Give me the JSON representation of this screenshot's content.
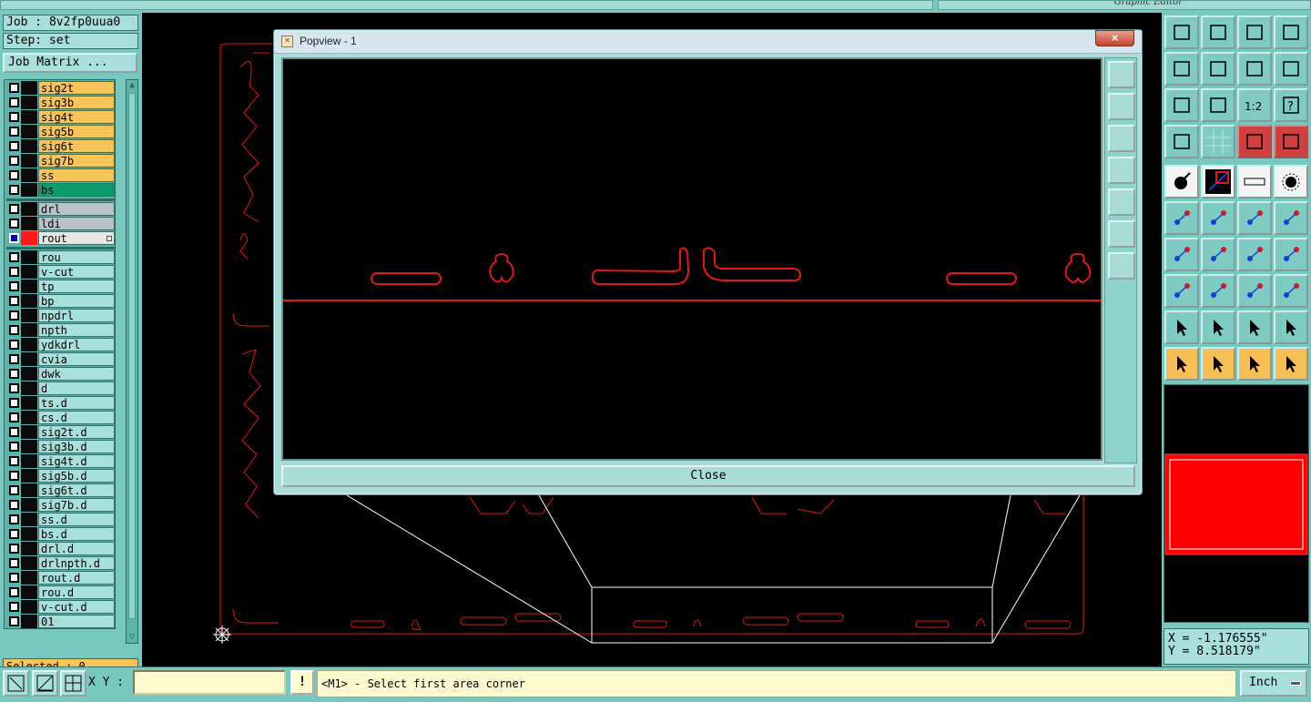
{
  "app": {
    "title": "Graphic Editor"
  },
  "left_panel": {
    "job_label": "Job : 8v2fp0uua0",
    "step_label": "Step: set",
    "job_matrix_button": "Job Matrix ...",
    "layers_group1": [
      {
        "name": "sig2t",
        "color": "#f7c45a"
      },
      {
        "name": "sig3b",
        "color": "#f7c45a"
      },
      {
        "name": "sig4t",
        "color": "#f7c45a"
      },
      {
        "name": "sig5b",
        "color": "#f7c45a"
      },
      {
        "name": "sig6t",
        "color": "#f7c45a"
      },
      {
        "name": "sig7b",
        "color": "#f7c45a"
      },
      {
        "name": "ss",
        "color": "#f7c45a"
      },
      {
        "name": "bs",
        "color": "#0e9a6c"
      }
    ],
    "layers_group2": [
      {
        "name": "drl",
        "color": "#b7c3c6"
      },
      {
        "name": "ldi",
        "color": "#b7c3c6"
      },
      {
        "name": "rout",
        "color": "#e6e6e6",
        "active": true
      }
    ],
    "layers_group3": [
      "rou",
      "v-cut",
      "tp",
      "bp",
      "npdrl",
      "npth",
      "ydkdrl",
      "cvia",
      "dwk",
      "d",
      "ts.d",
      "cs.d",
      "sig2t.d",
      "sig3b.d",
      "sig4t.d",
      "sig5b.d",
      "sig6t.d",
      "sig7b.d",
      "ss.d",
      "bs.d",
      "drl.d",
      "drlnpth.d",
      "rout.d",
      "rou.d",
      "v-cut.d",
      "01"
    ],
    "selected_label": "Selected : 0"
  },
  "popview": {
    "title": "Popview - 1",
    "close_x": "×",
    "close_button": "Close"
  },
  "coords": {
    "x": "X = -1.176555\"",
    "y": "Y = 8.518179\""
  },
  "bottom": {
    "xy_label": "X Y :",
    "xy_value": "",
    "warn_label": "!",
    "status_text": "<M1> - Select first area corner",
    "units": "Inch"
  },
  "colors": {
    "feature": "#e01818",
    "accent_teal": "#77c9c0",
    "orange": "#f5bf55"
  },
  "right_toolbar_icons": [
    "open-in-icon",
    "open-out-icon",
    "home-icon",
    "grid-window-icon",
    "pan-left-icon",
    "pan-right-icon",
    "undo-view-icon",
    "redo-view-icon",
    "zoom-fit-icon",
    "zoom-center-icon",
    "scale-1-2-icon",
    "help-icon",
    "settings-icon",
    "grid-icon",
    "net-icon",
    "net-alt-icon",
    "pad-icon",
    "snap-icon",
    "ruler-icon",
    "circle-pad-icon",
    "connect-icon",
    "cross-icon",
    "line-point-icon",
    "line-point-alt-icon",
    "angle-icon",
    "line-icon",
    "rotate-icon",
    "mirror-icon",
    "pad-shape-icon",
    "dash-icon",
    "measure-icon",
    "pad-group-icon",
    "triangle-icon",
    "triangle-up-icon",
    "triangle-dim-icon",
    "triangle-cross-icon",
    "select-icon",
    "select-box-icon",
    "select-poly-icon",
    "select-net-icon"
  ]
}
